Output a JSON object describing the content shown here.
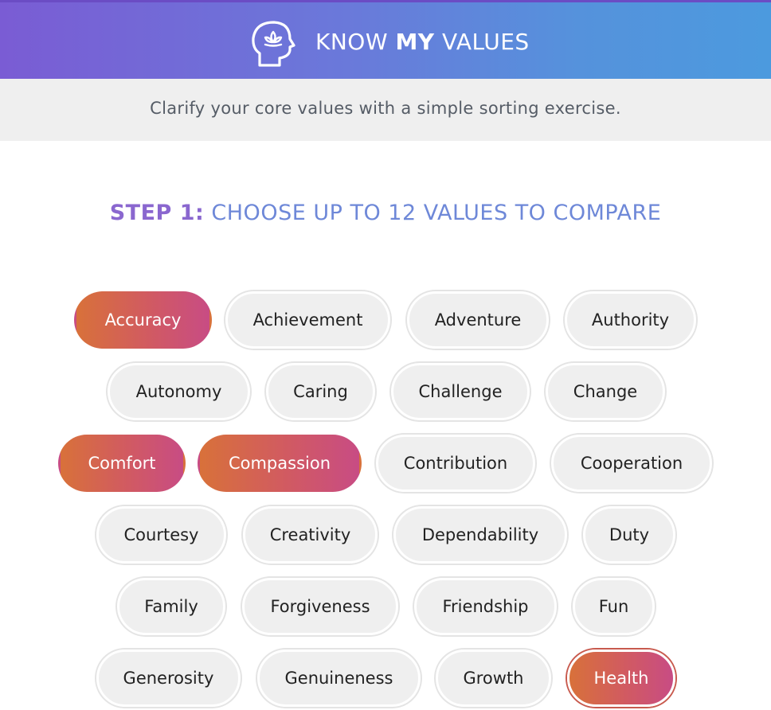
{
  "header": {
    "brand_part1": "KNOW",
    "brand_part2": "MY",
    "brand_part3": "VALUES",
    "logo_icon": "head-lotus-icon"
  },
  "tagline": "Clarify your core values with a simple sorting exercise.",
  "step": {
    "number_label": "STEP 1:",
    "instruction": "CHOOSE UP TO 12 VALUES TO COMPARE"
  },
  "colors": {
    "header_gradient_start": "#7a5cd4",
    "header_gradient_end": "#4c9ade",
    "selected_gradient_start": "#d8713a",
    "selected_gradient_end": "#c84c84",
    "chip_background": "#efefef"
  },
  "values": [
    {
      "label": "Accuracy",
      "selected": true
    },
    {
      "label": "Achievement",
      "selected": false
    },
    {
      "label": "Adventure",
      "selected": false
    },
    {
      "label": "Authority",
      "selected": false
    },
    {
      "label": "Autonomy",
      "selected": false
    },
    {
      "label": "Caring",
      "selected": false
    },
    {
      "label": "Challenge",
      "selected": false
    },
    {
      "label": "Change",
      "selected": false
    },
    {
      "label": "Comfort",
      "selected": true
    },
    {
      "label": "Compassion",
      "selected": true
    },
    {
      "label": "Contribution",
      "selected": false
    },
    {
      "label": "Cooperation",
      "selected": false
    },
    {
      "label": "Courtesy",
      "selected": false
    },
    {
      "label": "Creativity",
      "selected": false
    },
    {
      "label": "Dependability",
      "selected": false
    },
    {
      "label": "Duty",
      "selected": false
    },
    {
      "label": "Family",
      "selected": false
    },
    {
      "label": "Forgiveness",
      "selected": false
    },
    {
      "label": "Friendship",
      "selected": false
    },
    {
      "label": "Fun",
      "selected": false
    },
    {
      "label": "Generosity",
      "selected": false
    },
    {
      "label": "Genuineness",
      "selected": false
    },
    {
      "label": "Growth",
      "selected": false
    },
    {
      "label": "Health",
      "selected": true,
      "focused": true
    }
  ]
}
